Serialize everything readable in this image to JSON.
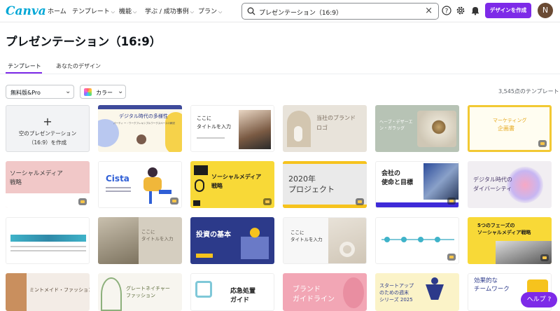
{
  "app": {
    "logo_text": "Canva"
  },
  "nav": {
    "home": "ホーム",
    "templates": "テンプレート",
    "features": "機能",
    "learn": "学ぶ / 成功事例",
    "plans": "プラン"
  },
  "search": {
    "value": "プレゼンテーション（16:9）"
  },
  "header": {
    "create_button": "デザインを作成",
    "avatar_initial": "N"
  },
  "page": {
    "title": "プレゼンテーション（16:9）"
  },
  "tabs": {
    "templates": "テンプレート",
    "your_designs": "あなたのデザイン"
  },
  "filters": {
    "price": "無料版&Pro",
    "color": "カラー"
  },
  "result_count": "3,545点のテンプレート",
  "blank_card": {
    "line1": "空のプレゼンテーション",
    "line2": "（16:9）を作成"
  },
  "cards": {
    "c1": {
      "title": "デジタル時代の多様性",
      "sub": "パーティ ー・ワークフレキシブルワークスペースの解説"
    },
    "c2": {
      "line1": "ここに",
      "line2": "タイトルを入力"
    },
    "c3": {
      "line1": "当社のブランド",
      "line2": "ロゴ"
    },
    "c4": {
      "line1": "ヘーブ・デザーエ",
      "line2": "ン・ガラッグ"
    },
    "c5": {
      "line1": "マーケティング",
      "line2": "企画書"
    },
    "c6": {
      "line1": "ソーシャルメディア",
      "line2": "戦略"
    },
    "c7": {
      "title": "Cista"
    },
    "c8": {
      "line1": "ソーシャルメディア",
      "line2": "戦略"
    },
    "c9": {
      "line1": "2020年",
      "line2": "プロジェクト"
    },
    "c10": {
      "line1": "会社の",
      "line2": "使命と目標"
    },
    "c11": {
      "line1": "デジタル時代の",
      "line2": "ダイバーシティ"
    },
    "c12": {
      "line1": "ここに",
      "line2": "タイトルを入力"
    },
    "c13": {
      "title": "投資の基本"
    },
    "c14": {
      "line1": "ここに",
      "line2": "タイトルを入力"
    },
    "c15": {
      "line1": "5つのフェーズの",
      "line2": "ソーシャルメディア戦略"
    },
    "c16": {
      "title": "ミントメイド・ファッション"
    },
    "c17": {
      "line1": "グレートネイチャー",
      "line2": "ファッション"
    },
    "c18": {
      "line1": "応急処置",
      "line2": "ガイド"
    },
    "c19": {
      "line1": "ブランド",
      "line2": "ガイドライン"
    },
    "c20": {
      "line1": "スタートアップ",
      "line2": "のための週末",
      "line3": "シリーズ 2025"
    },
    "c21": {
      "line1": "効果的な",
      "line2": "チームワーク"
    }
  },
  "help_button": "ヘルプ ?",
  "colors": {
    "accent": "#7d2ae8",
    "logo": "#00a7d6"
  }
}
